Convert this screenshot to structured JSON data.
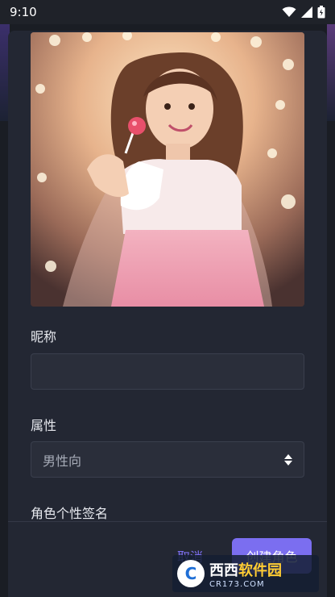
{
  "status_bar": {
    "time": "9:10",
    "icons": [
      "wifi-icon",
      "signal-icon",
      "battery-icon"
    ]
  },
  "dialog": {
    "avatar": {
      "icon": "character-portrait-image"
    },
    "nickname": {
      "label": "昵称",
      "value": "",
      "placeholder": ""
    },
    "attribute": {
      "label": "属性",
      "selected": "男性向",
      "icon": "sort-updown-icon"
    },
    "signature": {
      "label": "角色个性签名"
    },
    "actions": {
      "cancel_label": "取消",
      "create_label": "创建角色"
    }
  },
  "watermark": {
    "logo_text": "C",
    "brand_accent": "西西",
    "brand_main": "软件园",
    "domain": "CR173.COM"
  },
  "colors": {
    "background": "#1a1d24",
    "dialog": "#232733",
    "input": "#2a2e3a",
    "accent": "#7b6ef0",
    "text": "#e6e8ee",
    "muted": "#a7acb8"
  }
}
